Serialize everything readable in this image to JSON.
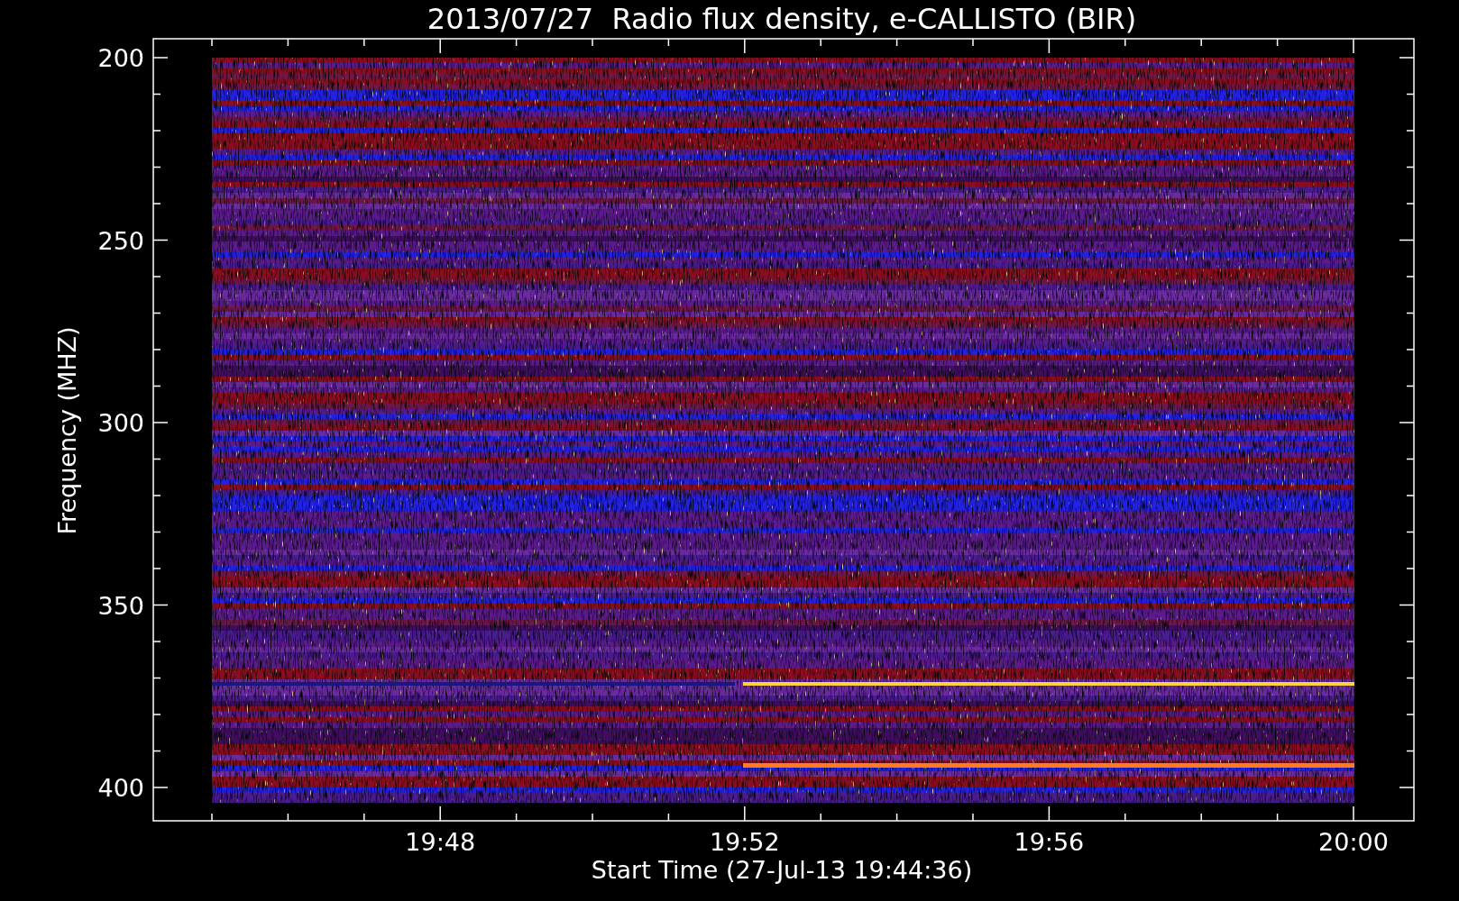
{
  "title": "2013/07/27  Radio flux density, e-CALLISTO (BIR)",
  "y_axis": {
    "label": "Frequency (MHZ)",
    "ticks": [
      "200",
      "250",
      "300",
      "350",
      "400"
    ]
  },
  "x_axis": {
    "label": "Start Time (27-Jul-13 19:44:36)",
    "ticks": [
      "19:48",
      "19:52",
      "19:56",
      "20:00"
    ]
  }
}
